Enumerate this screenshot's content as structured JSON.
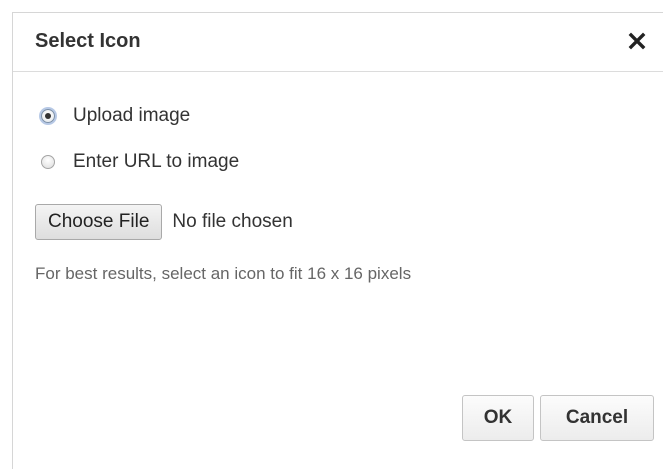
{
  "dialog": {
    "title": "Select Icon",
    "close_icon": "close-icon"
  },
  "source_options": [
    {
      "label": "Upload image",
      "selected": true
    },
    {
      "label": "Enter URL to image",
      "selected": false
    }
  ],
  "file_input": {
    "button_label": "Choose File",
    "status_text": "No file chosen"
  },
  "hint": "For best results, select an icon to fit 16 x 16 pixels",
  "footer": {
    "ok_label": "OK",
    "cancel_label": "Cancel"
  },
  "colors": {
    "title_text": "#333333",
    "hint_text": "#666666",
    "divider": "#dcdcdc",
    "radio_focus": "#b7c9e6"
  }
}
